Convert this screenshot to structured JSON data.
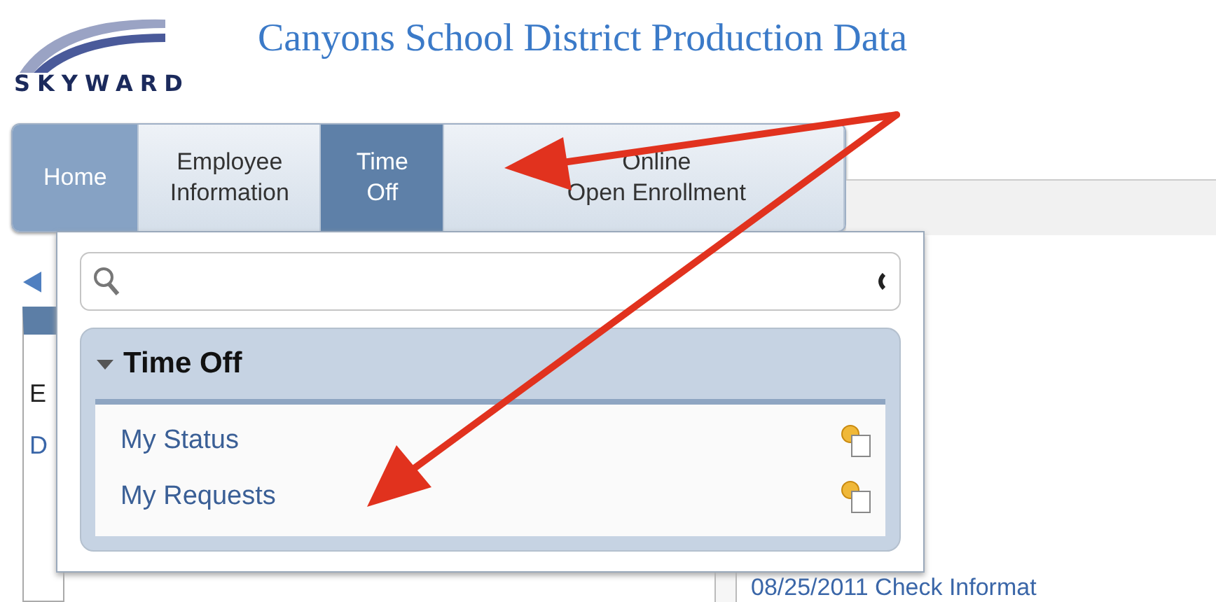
{
  "header": {
    "logo_text": "SKYWARD",
    "title": "Canyons School District Production Data"
  },
  "nav_tabs": [
    {
      "label": [
        "Home"
      ],
      "selected": false
    },
    {
      "label": [
        "Employee",
        "Information"
      ],
      "selected": false
    },
    {
      "label": [
        "Time",
        "Off"
      ],
      "selected": true
    },
    {
      "label": [
        "Online",
        "Open Enrollment"
      ],
      "selected": false
    }
  ],
  "background": {
    "table_fragments": [
      "E",
      "D"
    ],
    "link": "08/25/2011 Check Informat"
  },
  "menu": {
    "group": {
      "title": "Time Off",
      "expanded": true,
      "items": [
        {
          "label": "My Status"
        },
        {
          "label": "My Requests"
        }
      ]
    }
  },
  "annotations": [
    {
      "kind": "arrow"
    },
    {
      "kind": "arrow"
    }
  ]
}
